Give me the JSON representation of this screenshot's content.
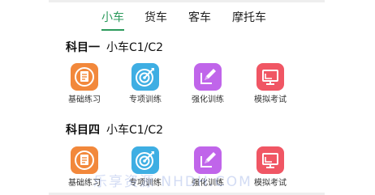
{
  "tabs": [
    {
      "label": "小车",
      "active": true
    },
    {
      "label": "货车",
      "active": false
    },
    {
      "label": "客车",
      "active": false
    },
    {
      "label": "摩托车",
      "active": false
    }
  ],
  "sections": [
    {
      "title": "科目一",
      "subtitle": "小车C1/C2",
      "items": [
        {
          "label": "基础练习",
          "icon": "document-icon",
          "color": "#f2883b"
        },
        {
          "label": "专项训练",
          "icon": "target-icon",
          "color": "#3eaee3"
        },
        {
          "label": "强化训练",
          "icon": "pencil-icon",
          "color": "#c065ea"
        },
        {
          "label": "模拟考试",
          "icon": "monitor-icon",
          "color": "#f05664"
        }
      ]
    },
    {
      "title": "科目四",
      "subtitle": "小车C1/C2",
      "items": [
        {
          "label": "基础练习",
          "icon": "document-icon",
          "color": "#f2883b"
        },
        {
          "label": "专项训练",
          "icon": "target-icon",
          "color": "#3eaee3"
        },
        {
          "label": "强化训练",
          "icon": "pencil-icon",
          "color": "#c065ea"
        },
        {
          "label": "模拟考试",
          "icon": "monitor-icon",
          "color": "#f05664"
        }
      ]
    }
  ],
  "watermark": "乐享资源 NHDH.COM"
}
